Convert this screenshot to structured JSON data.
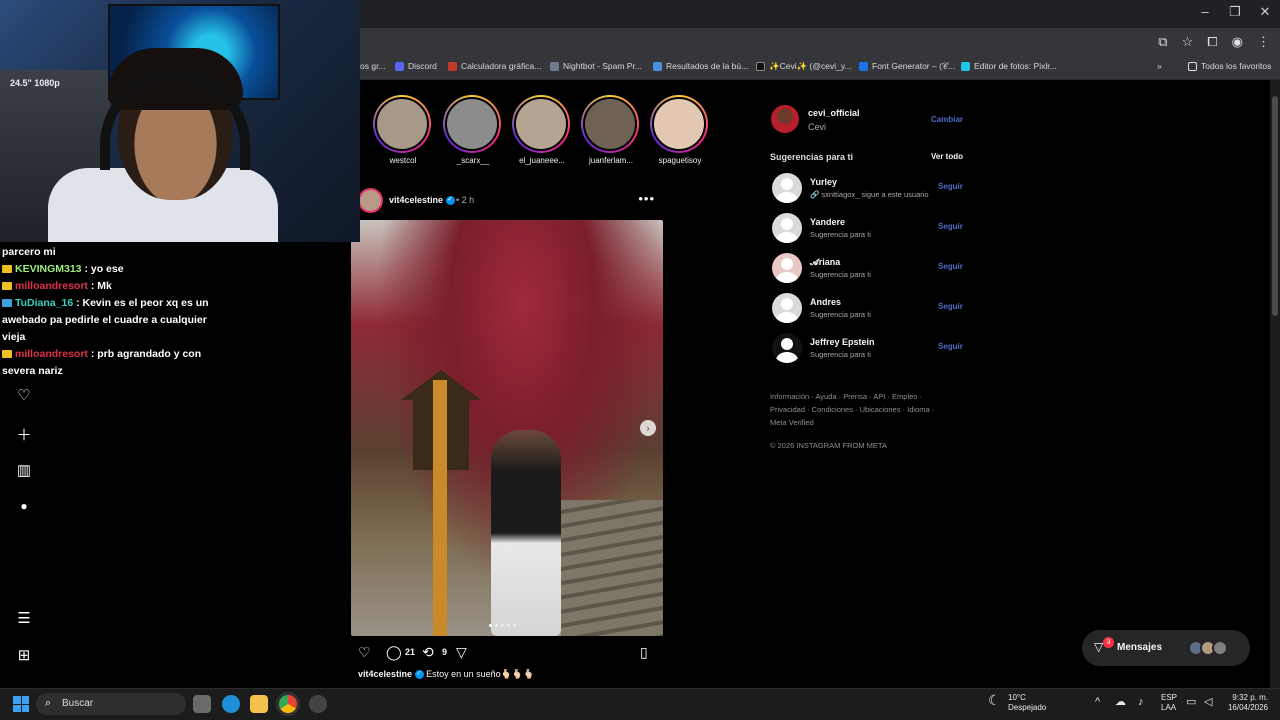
{
  "browser": {
    "bookmarks": [
      {
        "label": "os gr...",
        "color": "#555555"
      },
      {
        "label": "Discord",
        "color": "#5865f2"
      },
      {
        "label": "Calculadora gráfica...",
        "color": "#c0392b"
      },
      {
        "label": "Nightbot - Spam Pr...",
        "color": "#6c7a89"
      },
      {
        "label": "Resultados de la bú...",
        "color": "#4a90e2"
      },
      {
        "label": "✨Cevi✨ (@cevi_y...",
        "color": "#111111"
      },
      {
        "label": "Font Generator – (𝒞...",
        "color": "#1a73e8"
      },
      {
        "label": "Editor de fotos: Pixlr...",
        "color": "#22c3e6"
      }
    ],
    "favorites_label": "Todos los favoritos",
    "more_label": "»"
  },
  "stories": [
    {
      "name": "westcol"
    },
    {
      "name": "_scarx__"
    },
    {
      "name": "el_juaneee..."
    },
    {
      "name": "juanferlam..."
    },
    {
      "name": "spaguetisoy"
    }
  ],
  "post": {
    "user": "vit4celestine",
    "time": "• 2 h",
    "comments": "21",
    "reposts": "9",
    "caption_user": "vit4celestine",
    "caption_text": "Estoy en un sueño🫰🏻🫰🏻🫰🏻",
    "carousel_index": 1,
    "carousel_total": 5
  },
  "sidebar": {
    "me_user": "cevi_official",
    "me_name": "Cevi",
    "switch_label": "Cambiar",
    "suggestions_title": "Sugerencias para ti",
    "see_all": "Ver todo",
    "follow_label": "Seguir",
    "suggestions": [
      {
        "user": "Yurley",
        "sub": "🔗 sxnttiagox_ sigue a este usuario"
      },
      {
        "user": "Yandere",
        "sub": "Sugerencia para ti"
      },
      {
        "user": "𝓐riana",
        "sub": "Sugerencia para ti"
      },
      {
        "user": "Andres",
        "sub": "Sugerencia para ti"
      },
      {
        "user": "Jeffrey Epstein",
        "sub": "Sugerencia para ti"
      }
    ],
    "footer_line1": "Información · Ayuda · Prensa · API · Empleo ·",
    "footer_line2": "Privacidad · Condiciones · Ubicaciones · Idioma ·",
    "footer_line3": "Meta Verified",
    "copyright": "© 2026 INSTAGRAM FROM META"
  },
  "messages": {
    "label": "Mensajes",
    "badge": "3"
  },
  "chat": [
    {
      "user": "",
      "text": "parcero mi",
      "color": "#ffffff"
    },
    {
      "user": "KEVINGM313",
      "text": ": yo ese",
      "color": "#9ef07a"
    },
    {
      "user": "milloandresort",
      "text": ": Mk",
      "color": "#e0304a"
    },
    {
      "user": "TuDiana_16",
      "text": ": Kevin es el peor xq es un awebado pa pedirle el cuadre a cualquier vieja",
      "color": "#39d0c0"
    },
    {
      "user": "milloandresort",
      "text": ": prb agrandado y con severa nariz",
      "color": "#e0304a"
    }
  ],
  "webcam": {
    "monitor_text": "24.5\" 1080p"
  },
  "taskbar": {
    "search_placeholder": "Buscar",
    "weather_temp": "10°C",
    "weather_desc": "Despejado",
    "lang_1": "ESP",
    "lang_2": "LAA",
    "time": "9:32 p. m.",
    "date": "16/04/2026"
  }
}
